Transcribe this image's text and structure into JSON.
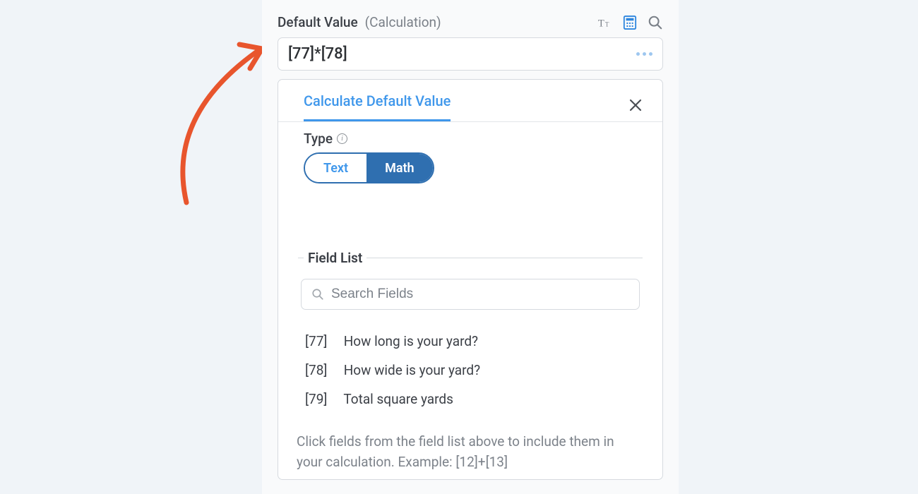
{
  "header": {
    "label": "Default Value",
    "sublabel": "(Calculation)"
  },
  "value_box": {
    "text": "[77]*[78]"
  },
  "card": {
    "tab_label": "Calculate Default Value",
    "type": {
      "label": "Type",
      "options": {
        "text": "Text",
        "math": "Math"
      }
    },
    "field_list": {
      "heading": "Field List",
      "search_placeholder": "Search Fields",
      "items": [
        {
          "id": "[77]",
          "label": "How long is your yard?"
        },
        {
          "id": "[78]",
          "label": "How wide is your yard?"
        },
        {
          "id": "[79]",
          "label": "Total square yards"
        }
      ]
    },
    "help_text": "Click fields from the field list above to include them in your calculation. Example: [12]+[13]"
  }
}
